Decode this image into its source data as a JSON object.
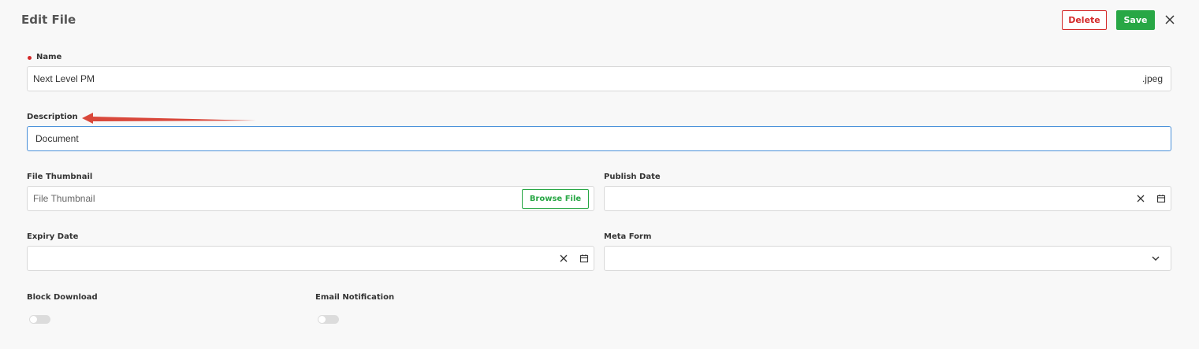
{
  "header": {
    "title": "Edit File",
    "delete_label": "Delete",
    "save_label": "Save"
  },
  "fields": {
    "name": {
      "label": "Name",
      "value": "Next Level PM",
      "suffix": ".jpeg"
    },
    "description": {
      "label": "Description",
      "value": "Document"
    },
    "file_thumbnail": {
      "label": "File Thumbnail",
      "placeholder": "File Thumbnail",
      "browse_label": "Browse File"
    },
    "publish_date": {
      "label": "Publish Date",
      "value": ""
    },
    "expiry_date": {
      "label": "Expiry Date",
      "value": ""
    },
    "meta_form": {
      "label": "Meta Form",
      "value": ""
    },
    "block_download": {
      "label": "Block Download",
      "enabled": false
    },
    "email_notification": {
      "label": "Email Notification",
      "enabled": false
    }
  },
  "colors": {
    "delete": "#d42a2a",
    "save": "#28a745",
    "focus_border": "#4a90d9",
    "annotation_arrow": "#d9483b"
  },
  "icons": [
    "close-icon",
    "clear-icon",
    "calendar-icon",
    "chevron-down-icon",
    "required-dot-icon",
    "annotation-arrow"
  ]
}
